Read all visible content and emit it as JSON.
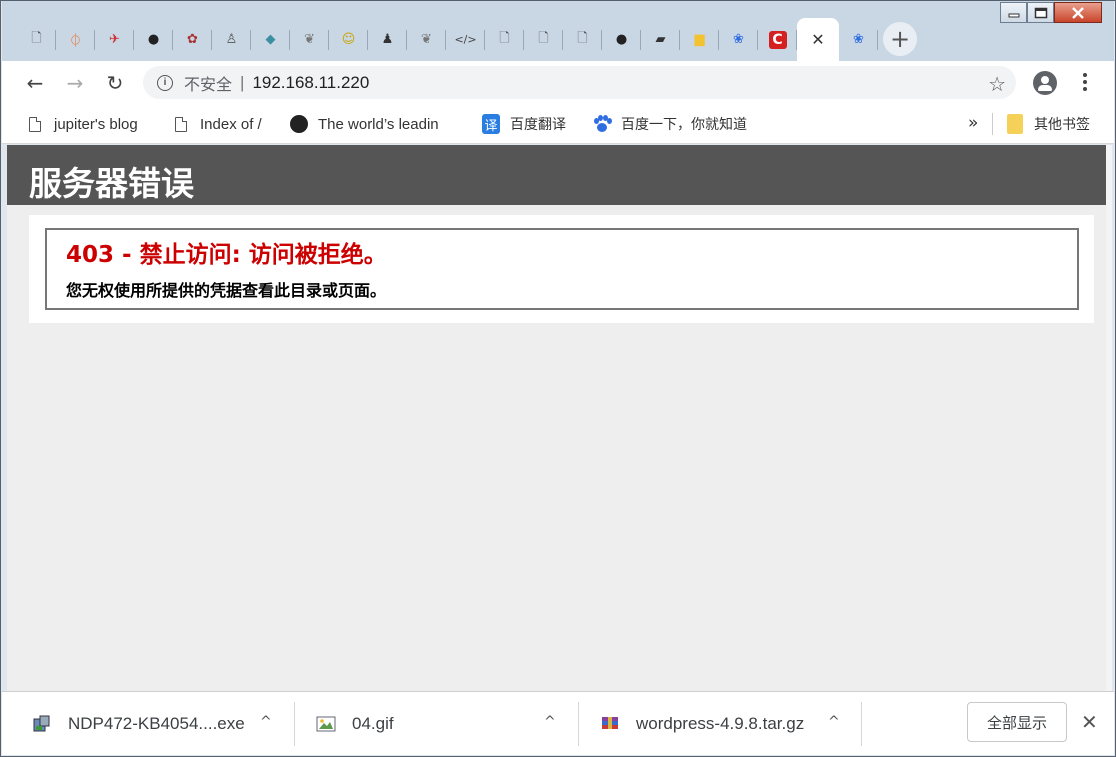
{
  "browser": {
    "tabs": [
      {
        "icon": "page-icon",
        "glyph": "🗋",
        "color": "#555555"
      },
      {
        "icon": "burp-icon",
        "glyph": "⏀",
        "color": "#e8742a"
      },
      {
        "icon": "tool-icon",
        "glyph": "✈",
        "color": "#cc3333"
      },
      {
        "icon": "github-icon",
        "glyph": "●",
        "color": "#222222"
      },
      {
        "icon": "anime-icon",
        "glyph": "✿",
        "color": "#aa3333"
      },
      {
        "icon": "penguin-icon",
        "glyph": "♙",
        "color": "#555555"
      },
      {
        "icon": "dragon-icon",
        "glyph": "◆",
        "color": "#3a8fa0"
      },
      {
        "icon": "doodle-icon",
        "glyph": "❦",
        "color": "#777777"
      },
      {
        "icon": "cartoon-icon",
        "glyph": "☺",
        "color": "#c9a400"
      },
      {
        "icon": "person-icon",
        "glyph": "♟",
        "color": "#333333"
      },
      {
        "icon": "doodle-icon",
        "glyph": "❦",
        "color": "#777777"
      },
      {
        "icon": "code-icon",
        "glyph": "</>",
        "color": "#444444"
      },
      {
        "icon": "page-icon",
        "glyph": "🗋",
        "color": "#555555"
      },
      {
        "icon": "page-icon",
        "glyph": "🗋",
        "color": "#555555"
      },
      {
        "icon": "page-icon",
        "glyph": "🗋",
        "color": "#555555"
      },
      {
        "icon": "github-icon",
        "glyph": "●",
        "color": "#222222"
      },
      {
        "icon": "book-icon",
        "glyph": "▰",
        "color": "#333333"
      },
      {
        "icon": "note-icon",
        "glyph": "▆",
        "color": "#f2c230"
      },
      {
        "icon": "baidu-icon",
        "glyph": "❀",
        "color": "#2f6ee0"
      },
      {
        "icon": "c-icon",
        "glyph": "C",
        "color": "#d42020"
      },
      {
        "icon": "close-icon",
        "glyph": "✕",
        "color": "#333333",
        "active": true
      },
      {
        "icon": "baidu-icon",
        "glyph": "❀",
        "color": "#2f6ee0"
      }
    ],
    "new_tab": "+",
    "url_security": "不安全",
    "url_sep": "|",
    "url": "192.168.11.220",
    "back": "←",
    "forward": "→",
    "reload": "↻",
    "star": "☆"
  },
  "bookmarks": {
    "items": [
      {
        "label": "jupiter's blog",
        "icon": "page-icon"
      },
      {
        "label": "Index of /",
        "icon": "page-icon"
      },
      {
        "label": "The world’s leadin",
        "icon": "github-icon"
      },
      {
        "label": "百度翻译",
        "icon": "translate-icon",
        "glyph": "译"
      },
      {
        "label": "百度一下，你就知道",
        "icon": "baidu-icon"
      }
    ],
    "more": "»",
    "other": "其他书签"
  },
  "page": {
    "header": "服务器错误",
    "error_title": "403 - 禁止访问: 访问被拒绝。",
    "error_desc": "您无权使用所提供的凭据查看此目录或页面。"
  },
  "downloads": {
    "items": [
      {
        "name": "NDP472-KB4054....exe",
        "icon": "installer-icon"
      },
      {
        "name": "04.gif",
        "icon": "image-icon"
      },
      {
        "name": "wordpress-4.9.8.tar.gz",
        "icon": "archive-icon"
      }
    ],
    "chevron": "^",
    "show_all": "全部显示",
    "close": "✕"
  }
}
